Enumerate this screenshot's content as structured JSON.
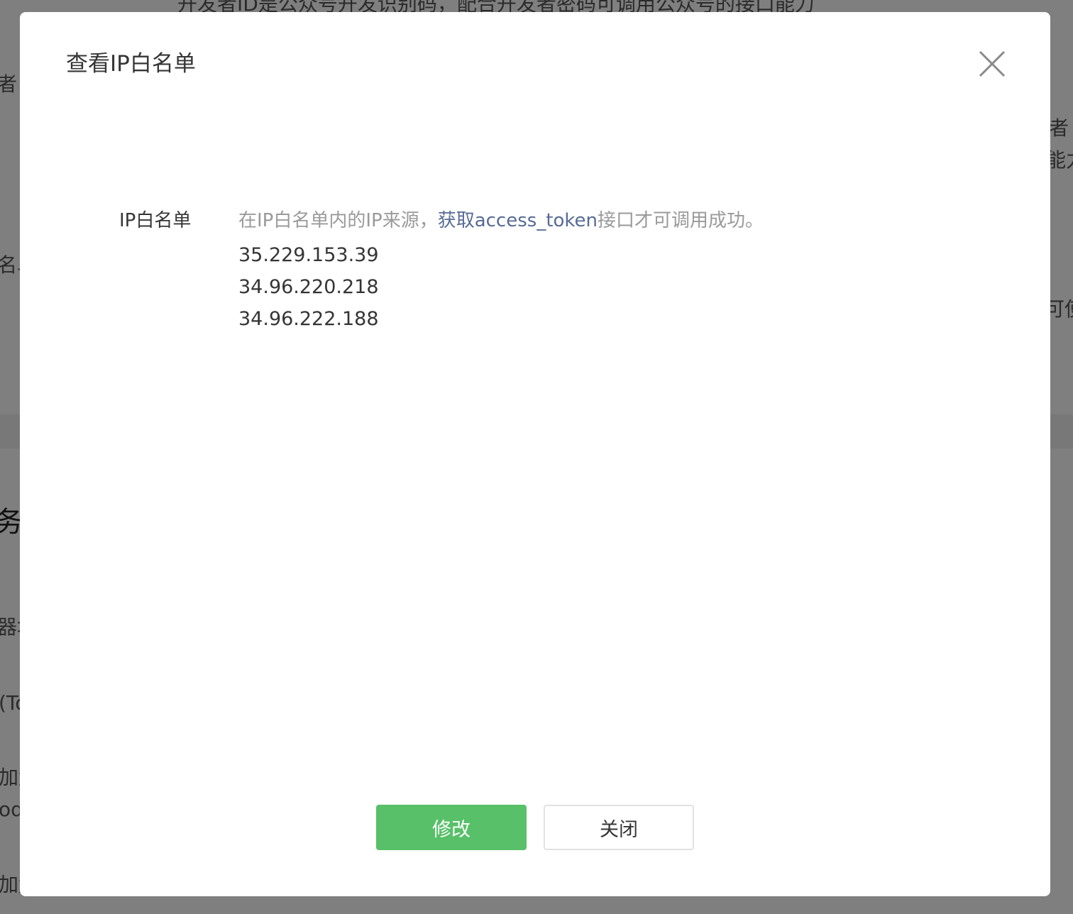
{
  "background": {
    "top_text": "开发者ID是公众号开发识别码，配合开发者密码可调用公众号的接口能力",
    "left_fragments": [
      "者",
      "名单",
      "务器",
      "器地",
      "(To",
      "加解",
      "od",
      "加解"
    ],
    "right_fragments": [
      "者",
      "能力",
      "可使"
    ]
  },
  "dialog": {
    "title": "查看IP白名单",
    "field_label": "IP白名单",
    "tip_before": "在IP白名单内的IP来源，",
    "tip_link": "获取access_token",
    "tip_after": "接口才可调用成功。",
    "ips": [
      "35.229.153.39",
      "34.96.220.218",
      "34.96.222.188"
    ],
    "modify_label": "修改",
    "close_label": "关闭"
  },
  "colors": {
    "primary": "#57c068",
    "link": "#576b95",
    "overlay": "rgba(0,0,0,0.5)"
  }
}
